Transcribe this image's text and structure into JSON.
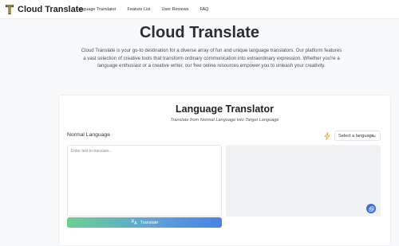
{
  "brand": {
    "name": "Cloud Translate"
  },
  "nav": [
    {
      "label": "Language Translator"
    },
    {
      "label": "Feature List"
    },
    {
      "label": "User Reviews"
    },
    {
      "label": "FAQ"
    }
  ],
  "hero": {
    "title": "Cloud Translate",
    "description": "Cloud Translate is your go-to destination for a diverse array of fun and unique language translators. Our platform features a vast selection of creative tools that transform ordinary communication into extraordinary expression. Whether you're a language enthusiast or a creative writer, our free online resources empower you to unleash your creativity."
  },
  "translator": {
    "title": "Language Translator",
    "subtitle": "Translate from Normal Language into Target Language",
    "source_label": "Normal Language",
    "target_select": "Select a language",
    "input_placeholder": "Enter text to translate...",
    "translate_label": "Translate"
  },
  "colors": {
    "accent": "#3b6fe0",
    "swap": "#e6b422",
    "logo": "#c9a227"
  },
  "icons": {
    "swap": "lightning-icon",
    "copy": "copy-icon",
    "translate": "translate-icon",
    "select": "chevron-down-icon"
  }
}
